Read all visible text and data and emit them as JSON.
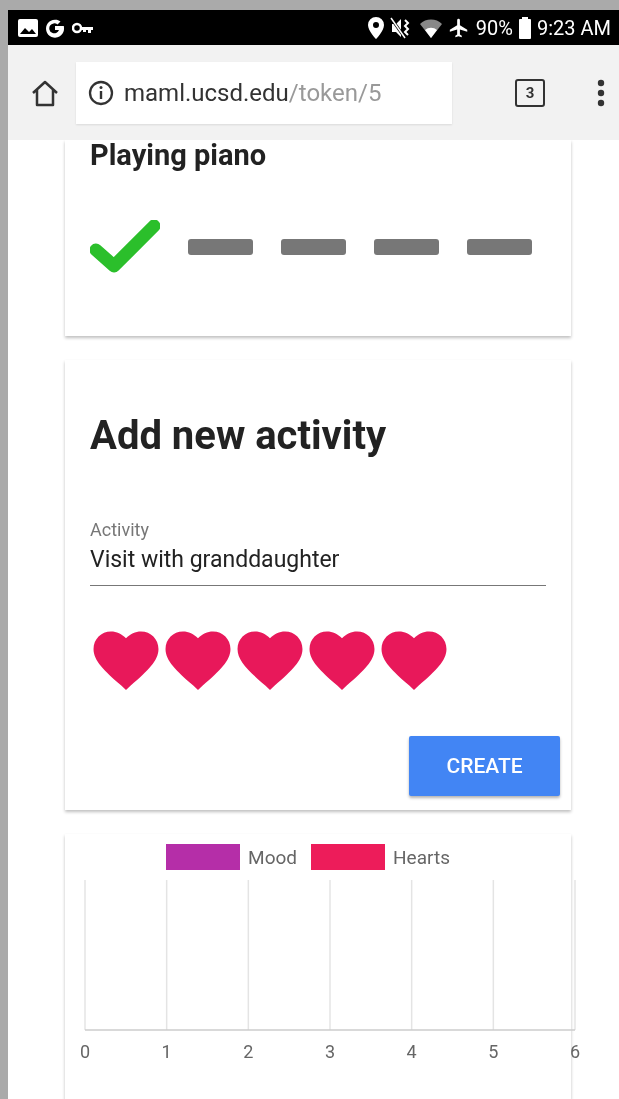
{
  "status_bar": {
    "battery": "90%",
    "time": "9:23 AM"
  },
  "browser": {
    "url_host": "maml.ucsd.edu",
    "url_path": "/token/5",
    "tab_count": "3"
  },
  "activity_card": {
    "title": "Playing piano",
    "steps": [
      {
        "done": true
      },
      {
        "done": false
      },
      {
        "done": false
      },
      {
        "done": false
      },
      {
        "done": false
      }
    ]
  },
  "new_activity": {
    "title": "Add new activity",
    "field_label": "Activity",
    "field_value": "Visit with granddaughter",
    "stars": 5,
    "button": "CREATE"
  },
  "chart": {
    "chart_data": {
      "type": "bar",
      "orientation": "horizontal",
      "series": [
        {
          "name": "Mood",
          "color": "#b52ea8"
        },
        {
          "name": "Hearts",
          "color": "#ed1c5a"
        }
      ],
      "grid": true,
      "xlim": [
        0,
        6
      ],
      "xticks": [
        0,
        1,
        2,
        3,
        4,
        5,
        6
      ]
    }
  }
}
